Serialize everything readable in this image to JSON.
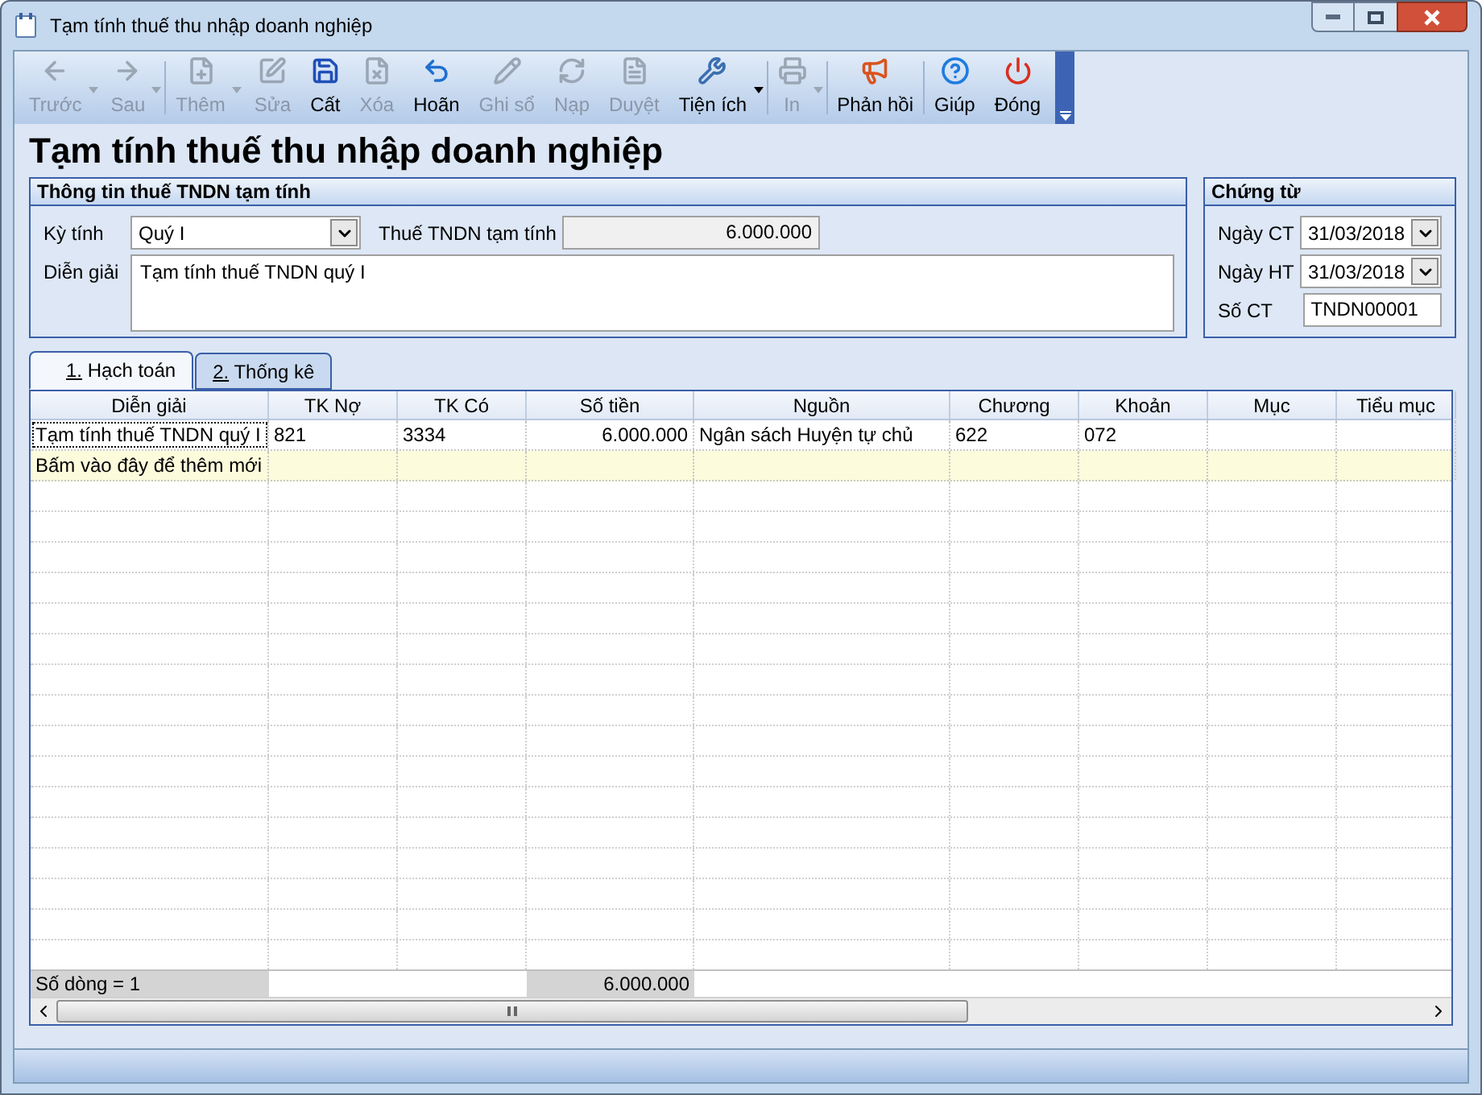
{
  "window": {
    "title": "Tạm tính thuế thu nhập doanh nghiệp"
  },
  "toolbar": [
    {
      "label": "Trước",
      "enabled": false,
      "dropdown": true,
      "separator_after": false
    },
    {
      "label": "Sau",
      "enabled": false,
      "dropdown": true,
      "separator_after": true
    },
    {
      "label": "Thêm",
      "enabled": false,
      "dropdown": true,
      "separator_after": false
    },
    {
      "label": "Sửa",
      "enabled": false,
      "dropdown": false,
      "separator_after": false
    },
    {
      "label": "Cất",
      "enabled": true,
      "dropdown": false,
      "separator_after": false
    },
    {
      "label": "Xóa",
      "enabled": false,
      "dropdown": false,
      "separator_after": false
    },
    {
      "label": "Hoãn",
      "enabled": true,
      "dropdown": false,
      "separator_after": false
    },
    {
      "label": "Ghi sổ",
      "enabled": false,
      "dropdown": false,
      "separator_after": false
    },
    {
      "label": "Nạp",
      "enabled": false,
      "dropdown": false,
      "separator_after": false
    },
    {
      "label": "Duyệt",
      "enabled": false,
      "dropdown": false,
      "separator_after": false
    },
    {
      "label": "Tiện ích",
      "enabled": true,
      "dropdown": true,
      "separator_after": true
    },
    {
      "label": "In",
      "enabled": false,
      "dropdown": true,
      "separator_after": true
    },
    {
      "label": "Phản hồi",
      "enabled": true,
      "dropdown": false,
      "separator_after": true
    },
    {
      "label": "Giúp",
      "enabled": true,
      "dropdown": false,
      "separator_after": false
    },
    {
      "label": "Đóng",
      "enabled": true,
      "dropdown": false,
      "separator_after": false
    }
  ],
  "page_title": "Tạm tính thuế thu nhập doanh nghiệp",
  "info_group": {
    "title": "Thông tin thuế TNDN tạm tính",
    "period": {
      "label": "Kỳ tính",
      "value": "Quý I"
    },
    "tax": {
      "label": "Thuế TNDN tạm tính",
      "value": "6.000.000"
    },
    "description": {
      "label": "Diễn giải",
      "value": "Tạm tính thuế TNDN quý I"
    }
  },
  "voucher_group": {
    "title": "Chứng từ",
    "fields": [
      {
        "kind": "date",
        "label": "Ngày CT",
        "value": "31/03/2018"
      },
      {
        "kind": "date",
        "label": "Ngày HT",
        "value": "31/03/2018"
      },
      {
        "kind": "text",
        "label": "Số CT",
        "value": "TNDN00001"
      }
    ]
  },
  "tabs": [
    {
      "label": "1. Hạch toán",
      "selected": true
    },
    {
      "label": "2. Thống kê",
      "selected": false
    }
  ],
  "table": {
    "columns": [
      "Diễn giải",
      "TK Nợ",
      "TK Có",
      "Số tiền",
      "Nguồn",
      "Chương",
      "Khoản",
      "Mục",
      "Tiểu mục"
    ],
    "rows": [
      [
        "Tạm tính thuế TNDN quý I",
        "821",
        "3334",
        "6.000.000",
        "Ngân sách Huyện tự chủ",
        "622",
        "072",
        "",
        ""
      ]
    ],
    "new_row": "Bấm vào đây để thêm mới",
    "footer": {
      "count": "Số dòng = 1",
      "total": "6.000.000"
    }
  }
}
